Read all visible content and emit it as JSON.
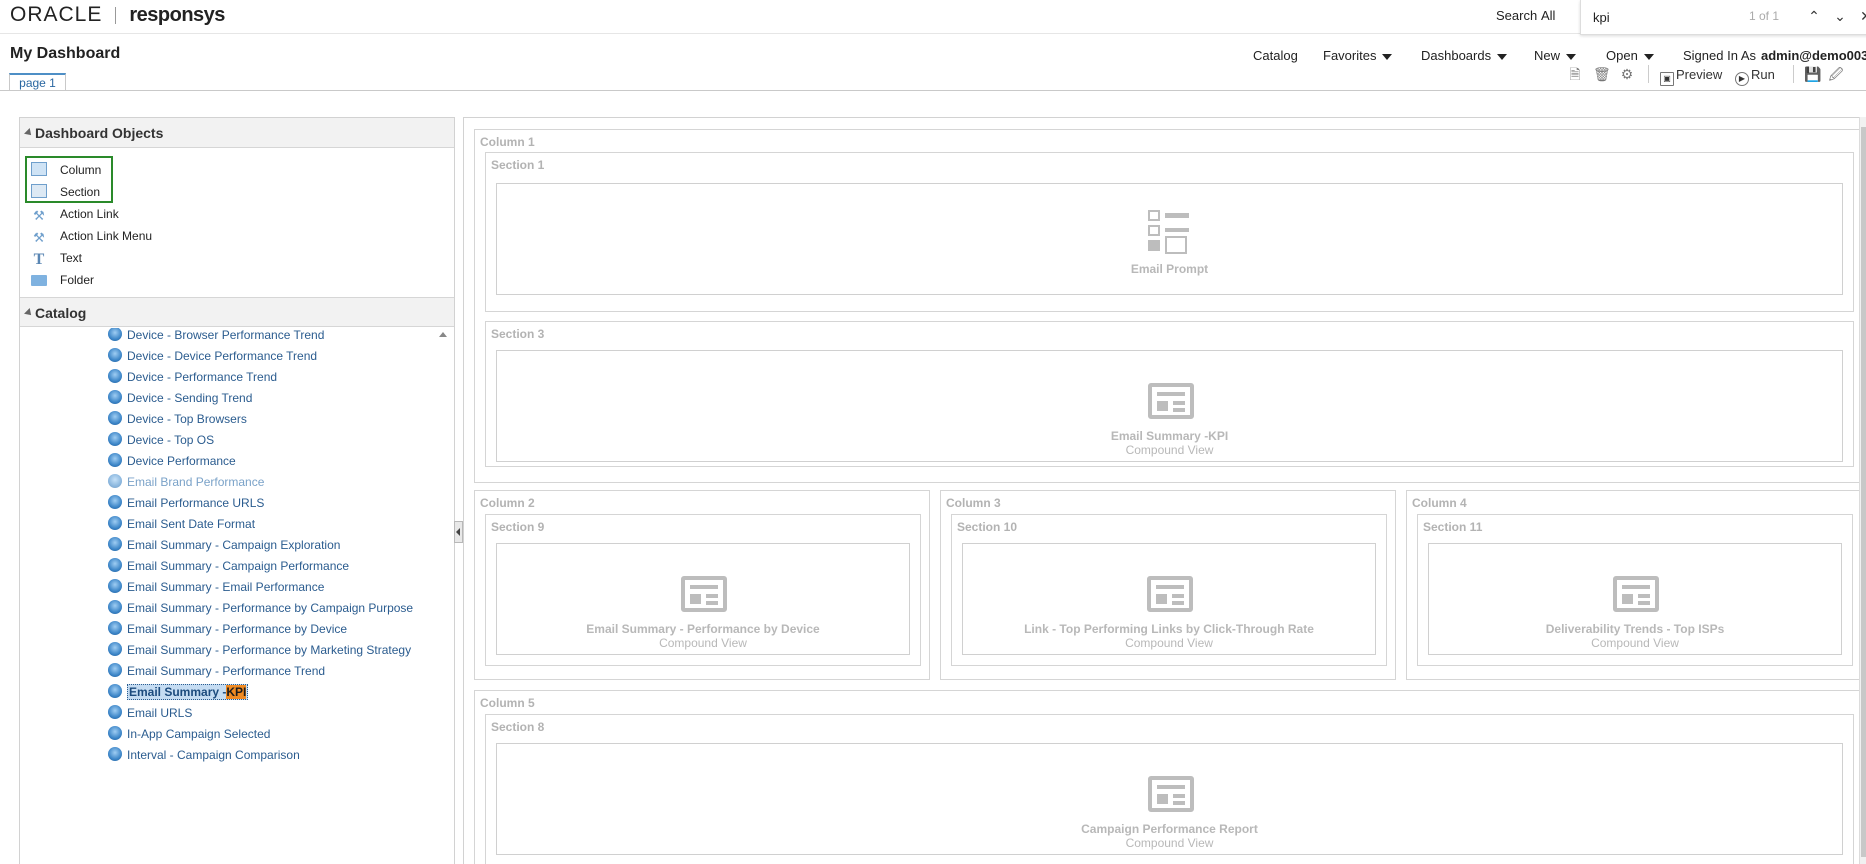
{
  "header": {
    "brand_oracle": "ORACLE",
    "brand_product": "responsys",
    "search_label": "Search",
    "search_scope": "All"
  },
  "find_bar": {
    "query": "kpi",
    "count": "1 of 1"
  },
  "nav": {
    "page_title": "My Dashboard",
    "catalog": "Catalog",
    "favorites": "Favorites",
    "dashboards": "Dashboards",
    "new": "New",
    "open": "Open",
    "signed_in_as": "Signed In As",
    "user": "admin@demo003"
  },
  "tabs": {
    "page1": "page 1"
  },
  "toolbar": {
    "preview": "Preview",
    "run": "Run"
  },
  "dashboard_objects": {
    "title": "Dashboard Objects",
    "items": [
      {
        "label": "Column",
        "icon": "column-icon"
      },
      {
        "label": "Section",
        "icon": "section-icon"
      },
      {
        "label": "Action Link",
        "icon": "action-link-icon"
      },
      {
        "label": "Action Link Menu",
        "icon": "action-link-menu-icon"
      },
      {
        "label": "Text",
        "icon": "text-icon"
      },
      {
        "label": "Folder",
        "icon": "folder-icon"
      }
    ]
  },
  "catalog": {
    "title": "Catalog",
    "items": [
      "Device - Browser Performance Trend",
      "Device - Device Performance Trend",
      "Device - Performance Trend",
      "Device - Sending Trend",
      "Device - Top Browsers",
      "Device - Top OS",
      "Device Performance",
      "Email Brand Performance",
      "Email Performance URLS",
      "Email Sent Date Format",
      "Email Summary - Campaign Exploration",
      "Email Summary - Campaign Performance",
      "Email Summary - Email Performance",
      "Email Summary - Performance by Campaign Purpose",
      "Email Summary - Performance by Device",
      "Email Summary - Performance by Marketing Strategy",
      "Email Summary - Performance Trend",
      "Email Summary -",
      "Email URLS",
      "In-App Campaign Selected",
      "Interval - Campaign Comparison"
    ],
    "selected_highlight": "KPI"
  },
  "layout": {
    "column1": "Column 1",
    "section1": "Section 1",
    "prompt_name": "Email Prompt",
    "section3": "Section 3",
    "kpi_name": "Email Summary -KPI",
    "compound_view": "Compound View",
    "column2": "Column 2",
    "section9": "Section 9",
    "device_name": "Email Summary - Performance by Device",
    "column3": "Column 3",
    "section10": "Section 10",
    "links_name": "Link - Top Performing Links by Click-Through Rate",
    "column4": "Column 4",
    "section11": "Section 11",
    "isps_name": "Deliverability Trends - Top ISPs",
    "column5": "Column 5",
    "section8": "Section 8",
    "campaign_name": "Campaign Performance Report"
  }
}
